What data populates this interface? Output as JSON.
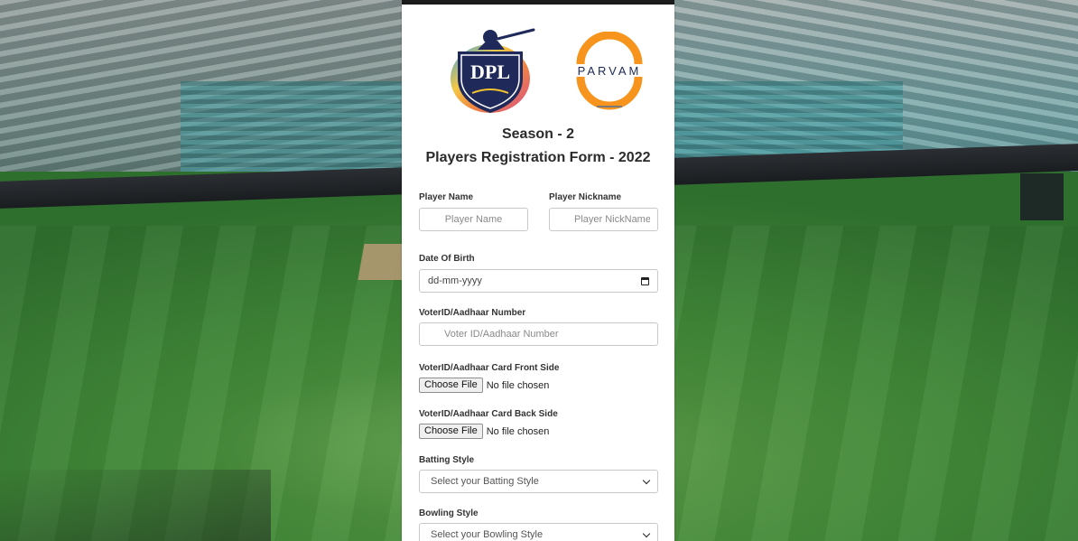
{
  "header": {
    "brand_left": "DPL",
    "brand_right": "PARVAM",
    "season": "Season - 2",
    "form_title": "Players Registration Form - 2022"
  },
  "form": {
    "player_name": {
      "label": "Player Name",
      "placeholder": "Player Name"
    },
    "player_nickname": {
      "label": "Player Nickname",
      "placeholder": "Player NickName"
    },
    "dob": {
      "label": "Date Of Birth",
      "value": "dd-mm-yyyy"
    },
    "voter_id": {
      "label": "VoterID/Aadhaar Number",
      "placeholder": "Voter ID/Aadhaar Number"
    },
    "card_front": {
      "label": "VoterID/Aadhaar Card Front Side",
      "button": "Choose File",
      "status": "No file chosen"
    },
    "card_back": {
      "label": "VoterID/Aadhaar Card Back Side",
      "button": "Choose File",
      "status": "No file chosen"
    },
    "batting_style": {
      "label": "Batting Style",
      "selected": "Select your Batting Style"
    },
    "bowling_style": {
      "label": "Bowling Style",
      "selected": "Select your Bowling Style"
    }
  },
  "colors": {
    "card_bg": "#ffffff",
    "parvam_orange": "#f7941d",
    "dpl_navy": "#1f2a5a",
    "field_green": "#3f8637"
  }
}
